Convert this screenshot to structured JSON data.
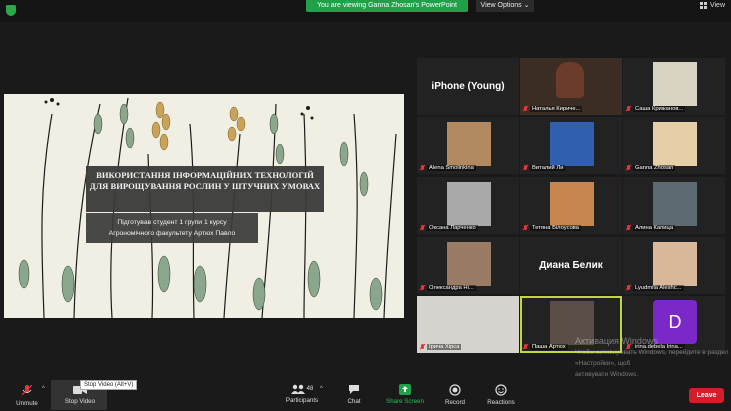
{
  "top": {
    "banner": "You are viewing Ganna Zhosan's PowerPoint",
    "view_options": "View Options ⌄",
    "view": "View"
  },
  "slide": {
    "title": "ВИКОРИСТАННЯ ІНФОРМАЦІЙНИХ ТЕХНОЛОГІЙ ДЛЯ ВИРОЩУВАННЯ РОСЛИН У ШТУЧНИХ УМОВАХ",
    "subtitle_line1": "Підготував студент 1 групи 1 курсу",
    "subtitle_line2": "Агрономічного факультету Артюх Павло"
  },
  "participants": [
    {
      "name": "iPhone (Young)",
      "type": "text"
    },
    {
      "name": "Наталья Кириче...",
      "type": "video"
    },
    {
      "name": "Саша Крижанов...",
      "type": "video"
    },
    {
      "name": "Alena Smolinkina",
      "type": "video"
    },
    {
      "name": "Виталий Ли",
      "type": "video"
    },
    {
      "name": "Ganna Zhosan",
      "type": "video"
    },
    {
      "name": "Оксана Ларченко",
      "type": "video"
    },
    {
      "name": "Тетяна Білоусова",
      "type": "video"
    },
    {
      "name": "Алина Капица",
      "type": "video"
    },
    {
      "name": "Олександра Ні...",
      "type": "video"
    },
    {
      "name": "Диана Белик",
      "type": "text"
    },
    {
      "name": "Lyudmila Aleshc...",
      "type": "video"
    },
    {
      "name": "Ірича Хірса",
      "type": "video"
    },
    {
      "name": "Паша Артюх",
      "type": "video"
    },
    {
      "name": "irina.debela Irina...",
      "type": "avatar",
      "initial": "D"
    }
  ],
  "watermark": {
    "line1": "Активация Windows",
    "line2": "Чтобы активировать Windows, перейдите в раздел «Настройки», щоб",
    "line3": "активувати Windows."
  },
  "toolbar": {
    "unmute": "Unmute",
    "stop_video": "Stop Video",
    "tooltip": "Stop Video (Alt+V)",
    "participants": "Participants",
    "participants_count": "48",
    "chat": "Chat",
    "share_screen": "Share Screen",
    "record": "Record",
    "reactions": "Reactions",
    "leave": "Leave"
  },
  "colors": {
    "green": "#21a04a",
    "leave": "#d11e2b",
    "active_border": "#c5d63a",
    "avatar": "#7b28c9"
  }
}
